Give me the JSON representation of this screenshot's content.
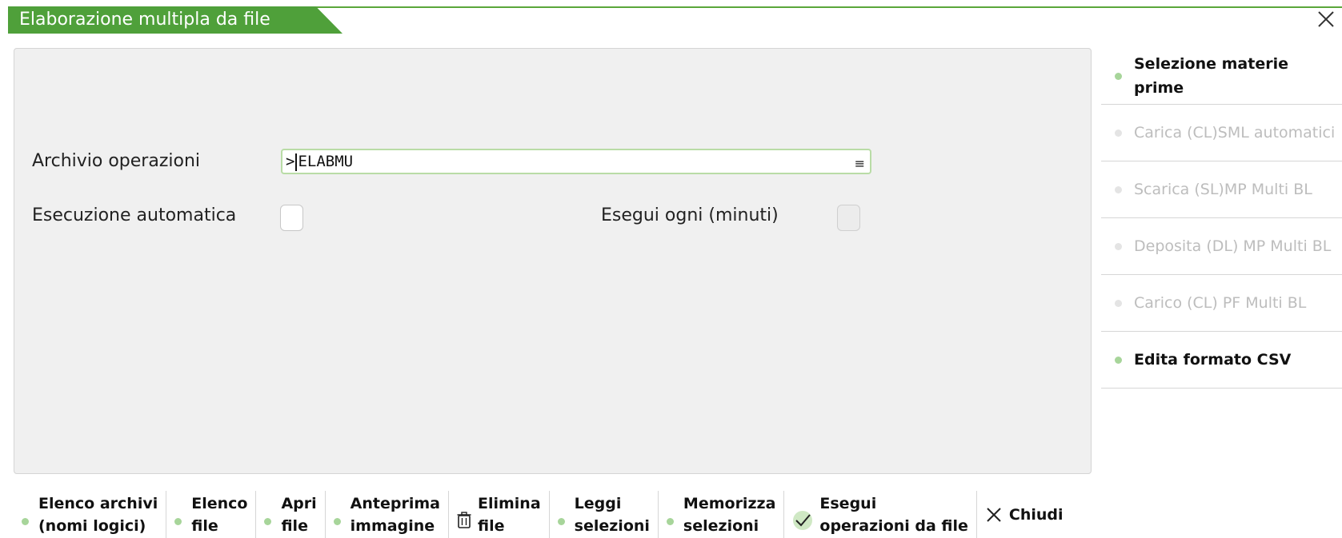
{
  "window": {
    "title": "Elaborazione multipla da file",
    "close_icon": "close-icon"
  },
  "form": {
    "archivio_label": "Archivio operazioni",
    "archivio_value_prefix": ">",
    "archivio_value": "ELABMU",
    "archivio_menu_icon": "≡",
    "esecuzione_label": "Esecuzione automatica",
    "esecuzione_checked": false,
    "esegui_ogni_label": "Esegui ogni (minuti)",
    "esegui_ogni_enabled": false
  },
  "side_menu": [
    {
      "label": "Selezione materie prime",
      "enabled": true
    },
    {
      "label": "Carica (CL)SML automatici",
      "enabled": false
    },
    {
      "label": "Scarica (SL)MP Multi BL",
      "enabled": false
    },
    {
      "label": "Deposita (DL) MP Multi BL",
      "enabled": false
    },
    {
      "label": "Carico (CL) PF Multi BL",
      "enabled": false
    },
    {
      "label": "Edita formato CSV",
      "enabled": true
    }
  ],
  "toolbar": {
    "elenco_archivi": "Elenco archivi\n(nomi logici)",
    "elenco_file": "Elenco\nfile",
    "apri_file": "Apri\nfile",
    "anteprima": "Anteprima\nimmagine",
    "elimina_file": "Elimina\nfile",
    "leggi_selezioni": "Leggi\nselezioni",
    "memorizza_selezioni": "Memorizza\nselezioni",
    "esegui_operazioni": "Esegui\noperazioni da file",
    "chiudi": "Chiudi"
  },
  "colors": {
    "accent_green": "#4fa03a",
    "dot_green": "#a7d59a",
    "panel_bg": "#f0f0f0"
  }
}
